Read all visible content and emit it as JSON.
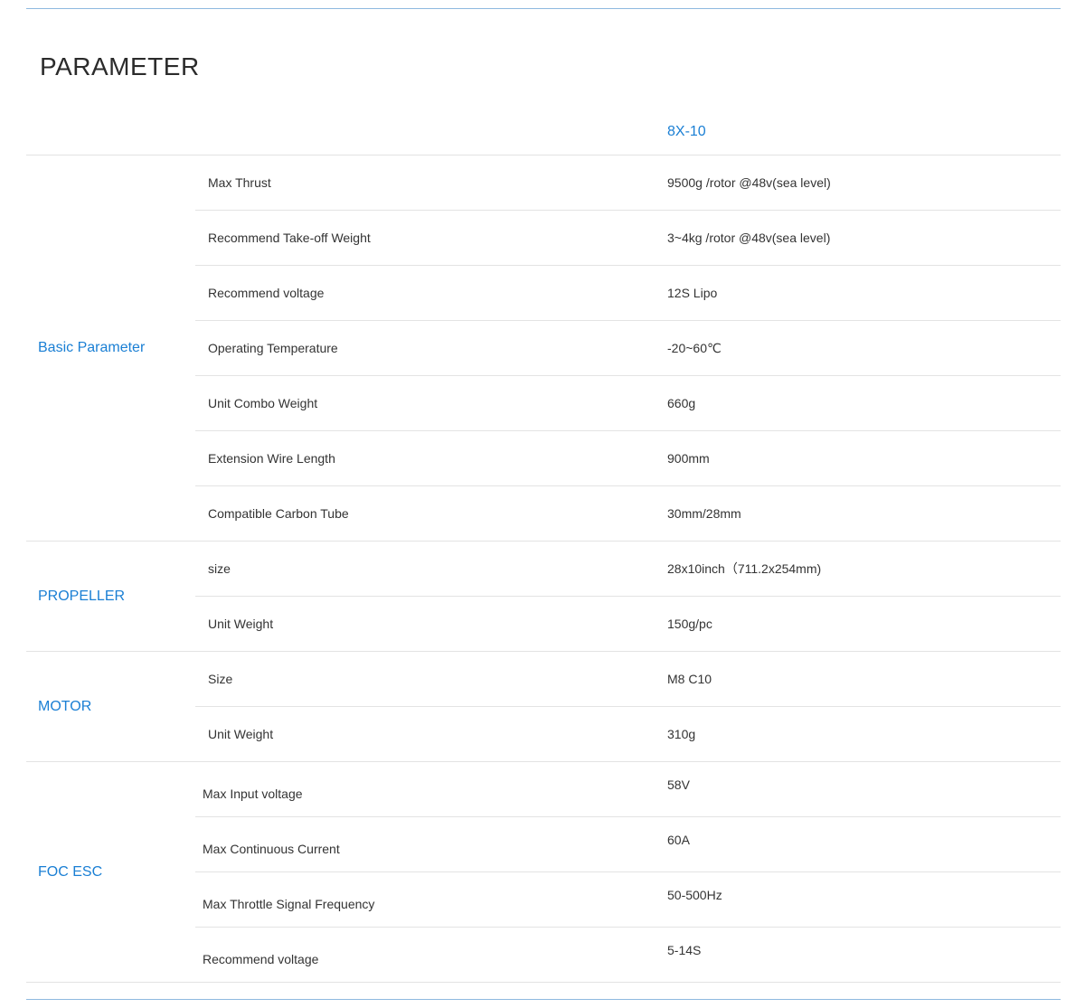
{
  "title": "PARAMETER",
  "model": "8X-10",
  "groups": [
    {
      "label": "Basic Parameter",
      "rows": [
        {
          "name": "Max Thrust",
          "value": "9500g /rotor @48v(sea level)"
        },
        {
          "name": "Recommend Take-off Weight",
          "value": "3~4kg /rotor @48v(sea level)"
        },
        {
          "name": "Recommend voltage",
          "value": "12S Lipo"
        },
        {
          "name": "Operating Temperature",
          "value": "-20~60℃"
        },
        {
          "name": "Unit Combo Weight",
          "value": "660g"
        },
        {
          "name": "Extension Wire Length",
          "value": "900mm"
        },
        {
          "name": "Compatible Carbon Tube",
          "value": "30mm/28mm"
        }
      ]
    },
    {
      "label": "PROPELLER",
      "rows": [
        {
          "name": "size",
          "value": "28x10inch（711.2x254mm)"
        },
        {
          "name": "Unit Weight",
          "value": "150g/pc"
        }
      ]
    },
    {
      "label": "MOTOR",
      "rows": [
        {
          "name": "Size",
          "value": "M8 C10"
        },
        {
          "name": "Unit Weight",
          "value": "310g"
        }
      ]
    },
    {
      "label": "FOC ESC",
      "rows": [
        {
          "name": "Max Input voltage",
          "value": "58V"
        },
        {
          "name": "Max Continuous Current",
          "value": "60A"
        },
        {
          "name": "Max Throttle Signal Frequency",
          "value": "50-500Hz"
        },
        {
          "name": "Recommend voltage",
          "value": "5-14S"
        }
      ]
    }
  ],
  "colors": {
    "accent": "#1a7fd4",
    "rule": "#8fb9e0",
    "divider": "#e3e3e3",
    "text": "#333333"
  }
}
